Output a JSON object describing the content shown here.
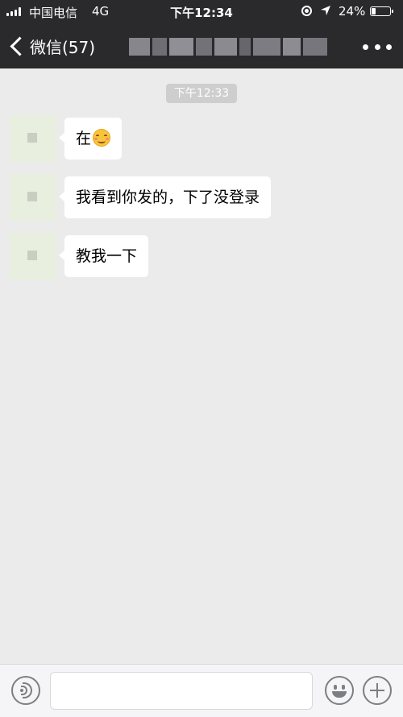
{
  "status_bar": {
    "carrier": "中国电信",
    "network": "4G",
    "time": "下午12:34",
    "battery_percent": "24%",
    "battery_level": 0.24
  },
  "nav": {
    "back_label": "微信(57)",
    "back_icon": "chevron-left-icon",
    "more_icon": "more-dots-icon"
  },
  "chat": {
    "timestamp": "下午12:33",
    "messages": [
      {
        "text": "在",
        "emoji": "smiling-face-icon"
      },
      {
        "text": "我看到你发的，下了没登录"
      },
      {
        "text": "教我一下"
      }
    ]
  },
  "input_bar": {
    "voice_icon": "voice-icon",
    "text_value": "",
    "emoji_icon": "emoji-icon",
    "plus_icon": "plus-icon"
  },
  "colors": {
    "top_bar": "#2a2a2c",
    "chat_background": "#ebebeb",
    "bubble": "#ffffff"
  }
}
